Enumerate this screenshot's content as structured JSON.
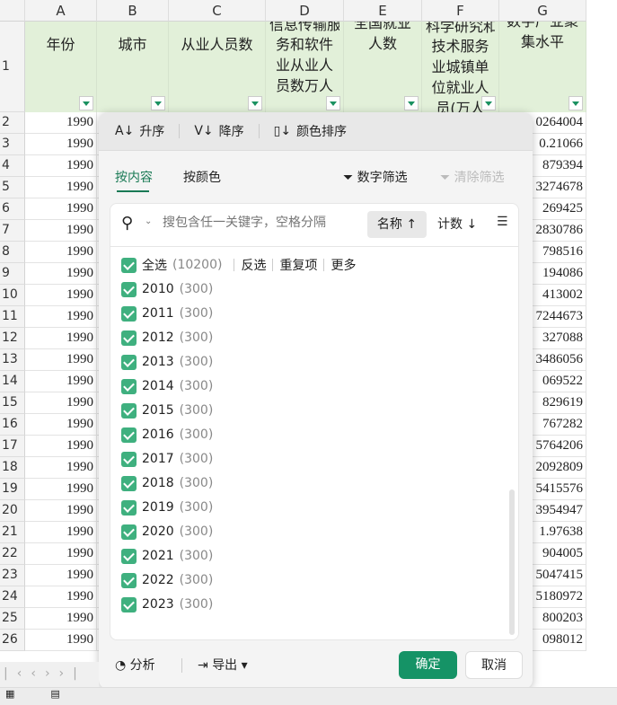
{
  "columns": [
    "A",
    "B",
    "C",
    "D",
    "E",
    "F",
    "G"
  ],
  "header_row": {
    "number": "1",
    "cells": [
      "年份",
      "城市",
      "从业人员数",
      "务和软件业从业人员数万人",
      "全国就业人数",
      "技术服务业城镇单位就业人员(万人",
      "数字产业聚集水平"
    ],
    "partial_top": {
      "D": "信息传输服",
      "F": "科学研究和"
    }
  },
  "rows": [
    {
      "n": "2",
      "a": "1990",
      "g": "0264004"
    },
    {
      "n": "3",
      "a": "1990",
      "g": "0.21066"
    },
    {
      "n": "4",
      "a": "1990",
      "g": "879394"
    },
    {
      "n": "5",
      "a": "1990",
      "g": "3274678"
    },
    {
      "n": "6",
      "a": "1990",
      "g": "269425"
    },
    {
      "n": "7",
      "a": "1990",
      "g": "2830786"
    },
    {
      "n": "8",
      "a": "1990",
      "g": "798516"
    },
    {
      "n": "9",
      "a": "1990",
      "g": "194086"
    },
    {
      "n": "10",
      "a": "1990",
      "g": "413002"
    },
    {
      "n": "11",
      "a": "1990",
      "g": "7244673"
    },
    {
      "n": "12",
      "a": "1990",
      "g": "327088"
    },
    {
      "n": "13",
      "a": "1990",
      "g": "3486056"
    },
    {
      "n": "14",
      "a": "1990",
      "g": "069522"
    },
    {
      "n": "15",
      "a": "1990",
      "g": "829619"
    },
    {
      "n": "16",
      "a": "1990",
      "g": "767282"
    },
    {
      "n": "17",
      "a": "1990",
      "g": "5764206"
    },
    {
      "n": "18",
      "a": "1990",
      "g": "2092809"
    },
    {
      "n": "19",
      "a": "1990",
      "g": "5415576"
    },
    {
      "n": "20",
      "a": "1990",
      "g": "3954947"
    },
    {
      "n": "21",
      "a": "1990",
      "g": "1.97638"
    },
    {
      "n": "22",
      "a": "1990",
      "g": "904005"
    },
    {
      "n": "23",
      "a": "1990",
      "g": "5047415"
    },
    {
      "n": "24",
      "a": "1990",
      "g": "5180972"
    },
    {
      "n": "25",
      "a": "1990",
      "g": "800203"
    },
    {
      "n": "26",
      "a": "1990",
      "g": "098012"
    }
  ],
  "popup": {
    "sort": {
      "asc": "升序",
      "desc": "降序",
      "color": "颜色排序"
    },
    "tabs": {
      "content": "按内容",
      "color": "按颜色"
    },
    "number_filter": "数字筛选",
    "clear_filter": "清除筛选",
    "search_placeholder": "搜包含任一关键字，空格分隔",
    "sort_name": "名称",
    "sort_count": "计数",
    "select_all": {
      "label": "全选",
      "count": "(10200)",
      "invert": "反选",
      "duplicates": "重复项",
      "more": "更多"
    },
    "items": [
      {
        "label": "2010",
        "count": "(300)"
      },
      {
        "label": "2011",
        "count": "(300)"
      },
      {
        "label": "2012",
        "count": "(300)"
      },
      {
        "label": "2013",
        "count": "(300)"
      },
      {
        "label": "2014",
        "count": "(300)"
      },
      {
        "label": "2015",
        "count": "(300)"
      },
      {
        "label": "2016",
        "count": "(300)"
      },
      {
        "label": "2017",
        "count": "(300)"
      },
      {
        "label": "2018",
        "count": "(300)"
      },
      {
        "label": "2019",
        "count": "(300)"
      },
      {
        "label": "2020",
        "count": "(300)"
      },
      {
        "label": "2021",
        "count": "(300)"
      },
      {
        "label": "2022",
        "count": "(300)"
      },
      {
        "label": "2023",
        "count": "(300)"
      }
    ],
    "analyze": "分析",
    "export": "导出",
    "ok": "确定",
    "cancel": "取消"
  },
  "colors": {
    "accent": "#1a9160",
    "header_fill": "#e2f0d9"
  }
}
